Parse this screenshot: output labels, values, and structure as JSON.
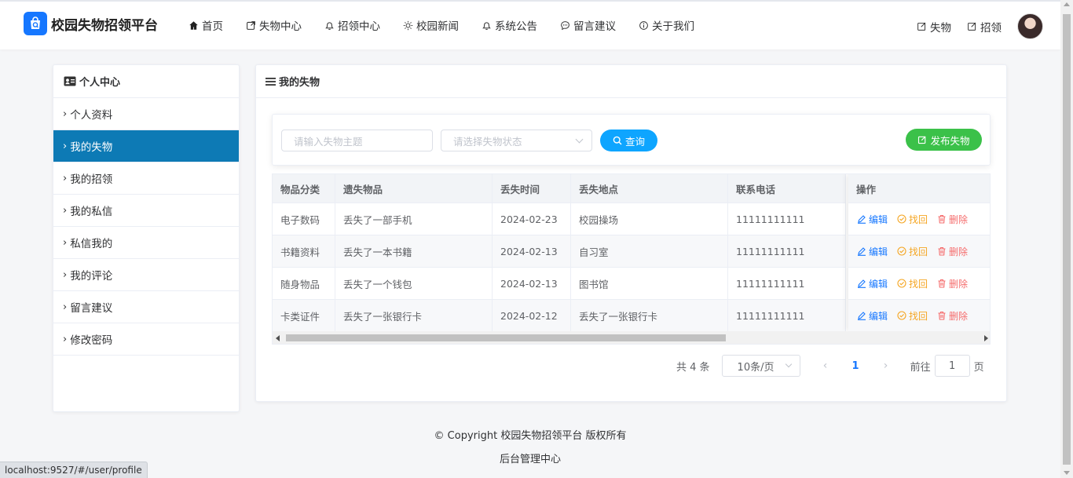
{
  "header": {
    "logo_text": "校园失物招领平台",
    "nav": [
      {
        "label": "首页",
        "icon": "home-icon"
      },
      {
        "label": "失物中心",
        "icon": "external-link-icon"
      },
      {
        "label": "招领中心",
        "icon": "bell-icon"
      },
      {
        "label": "校园新闻",
        "icon": "sun-icon"
      },
      {
        "label": "系统公告",
        "icon": "bell-icon"
      },
      {
        "label": "留言建议",
        "icon": "chat-icon"
      },
      {
        "label": "关于我们",
        "icon": "info-icon"
      }
    ],
    "right_buttons": [
      {
        "label": "失物",
        "icon": "edit-icon"
      },
      {
        "label": "招领",
        "icon": "edit-icon"
      }
    ]
  },
  "sidebar": {
    "title": "个人中心",
    "items": [
      {
        "label": "个人资料",
        "active": false
      },
      {
        "label": "我的失物",
        "active": true
      },
      {
        "label": "我的招领",
        "active": false
      },
      {
        "label": "我的私信",
        "active": false
      },
      {
        "label": "私信我的",
        "active": false
      },
      {
        "label": "我的评论",
        "active": false
      },
      {
        "label": "留言建议",
        "active": false
      },
      {
        "label": "修改密码",
        "active": false
      }
    ]
  },
  "main": {
    "title": "我的失物",
    "search": {
      "subject_placeholder": "请输入失物主题",
      "status_placeholder": "请选择失物状态",
      "query_label": "查询",
      "publish_label": "发布失物"
    },
    "table": {
      "columns": [
        "物品分类",
        "遗失物品",
        "丢失时间",
        "丢失地点",
        "联系电话",
        "操作"
      ],
      "rows": [
        [
          "电子数码",
          "丢失了一部手机",
          "2024-02-23",
          "校园操场",
          "11111111111"
        ],
        [
          "书籍资料",
          "丢失了一本书籍",
          "2024-02-13",
          "自习室",
          "11111111111"
        ],
        [
          "随身物品",
          "丢失了一个钱包",
          "2024-02-13",
          "图书馆",
          "11111111111"
        ],
        [
          "卡类证件",
          "丢失了一张银行卡",
          "2024-02-12",
          "丢失了一张银行卡",
          "11111111111"
        ]
      ],
      "actions": {
        "edit": "编辑",
        "find": "找回",
        "delete": "删除"
      }
    },
    "pager": {
      "total": "共 4 条",
      "page_size": "10条/页",
      "prev": "‹",
      "next": "›",
      "current": "1",
      "goto_label": "前往",
      "goto_value": "1",
      "page_label": "页"
    }
  },
  "footer": {
    "copyright": "© Copyright 校园失物招领平台 版权所有",
    "admin_link": "后台管理中心"
  },
  "statusbar": {
    "url": "localhost:9527/#/user/profile"
  },
  "colors": {
    "primary": "#1677ff",
    "active_side": "#0d7ab5",
    "query_btn": "#0ea5ff",
    "publish_btn": "#3bc149",
    "find": "#f5a623",
    "delete": "#f56c6c"
  }
}
